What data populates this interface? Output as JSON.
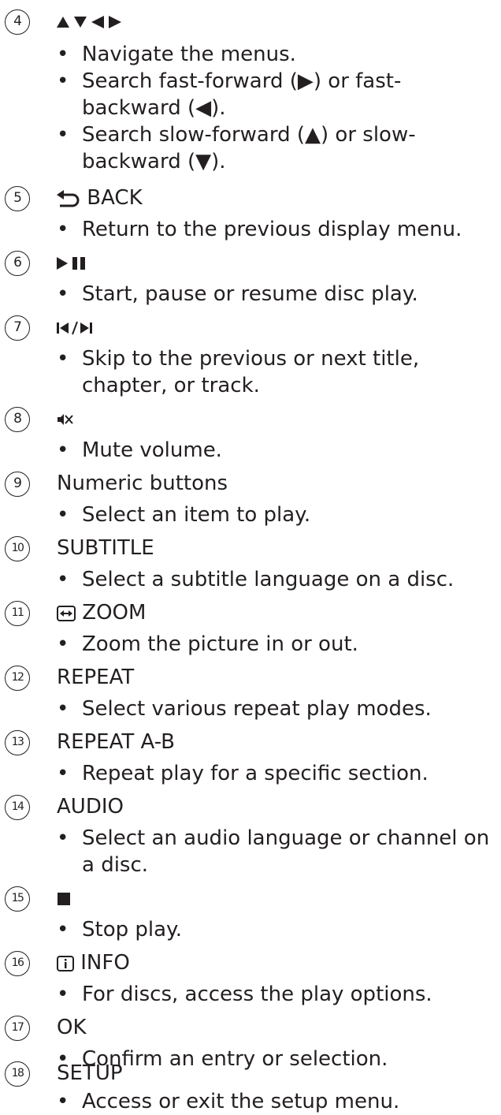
{
  "items": [
    {
      "number": "4",
      "heading": "",
      "icon": "arrows-icon",
      "bullets": [
        "Navigate the menus.",
        "Search fast-forward (▶) or fast-backward (◀).",
        "Search slow-forward (▲) or slow-backward (▼)."
      ]
    },
    {
      "number": "5",
      "heading": "BACK",
      "icon": "back-icon",
      "bullets": [
        "Return to the previous display menu."
      ]
    },
    {
      "number": "6",
      "heading": "",
      "icon": "play-pause-icon",
      "bullets": [
        "Start, pause or resume disc play."
      ]
    },
    {
      "number": "7",
      "heading": "",
      "icon": "skip-icon",
      "bullets": [
        "Skip to the previous or next title, chapter, or track."
      ]
    },
    {
      "number": "8",
      "heading": "",
      "icon": "mute-icon",
      "bullets": [
        "Mute volume."
      ]
    },
    {
      "number": "9",
      "heading": "Numeric buttons",
      "icon": "",
      "bullets": [
        "Select an item to play."
      ]
    },
    {
      "number": "10",
      "heading": "SUBTITLE",
      "icon": "",
      "bullets": [
        "Select a subtitle language on a disc."
      ]
    },
    {
      "number": "11",
      "heading": "ZOOM",
      "icon": "zoom-icon",
      "bullets": [
        "Zoom the picture in or out."
      ]
    },
    {
      "number": "12",
      "heading": "REPEAT",
      "icon": "",
      "bullets": [
        "Select various repeat play modes."
      ]
    },
    {
      "number": "13",
      "heading": "REPEAT A-B",
      "icon": "",
      "bullets": [
        "Repeat play for a specific section."
      ]
    },
    {
      "number": "14",
      "heading": "AUDIO",
      "icon": "",
      "bullets": [
        "Select an audio language or channel on a disc."
      ]
    },
    {
      "number": "15",
      "heading": "",
      "icon": "stop-icon",
      "bullets": [
        "Stop play."
      ]
    },
    {
      "number": "16",
      "heading": "INFO",
      "icon": "info-icon",
      "bullets": [
        "For discs, access the play options."
      ]
    },
    {
      "number": "17",
      "heading": "OK",
      "icon": "",
      "bullets": [
        "Confirm an entry or selection."
      ]
    },
    {
      "number": "18",
      "heading": "SETUP",
      "icon": "",
      "bullets": [
        "Access or exit the setup menu."
      ]
    }
  ]
}
